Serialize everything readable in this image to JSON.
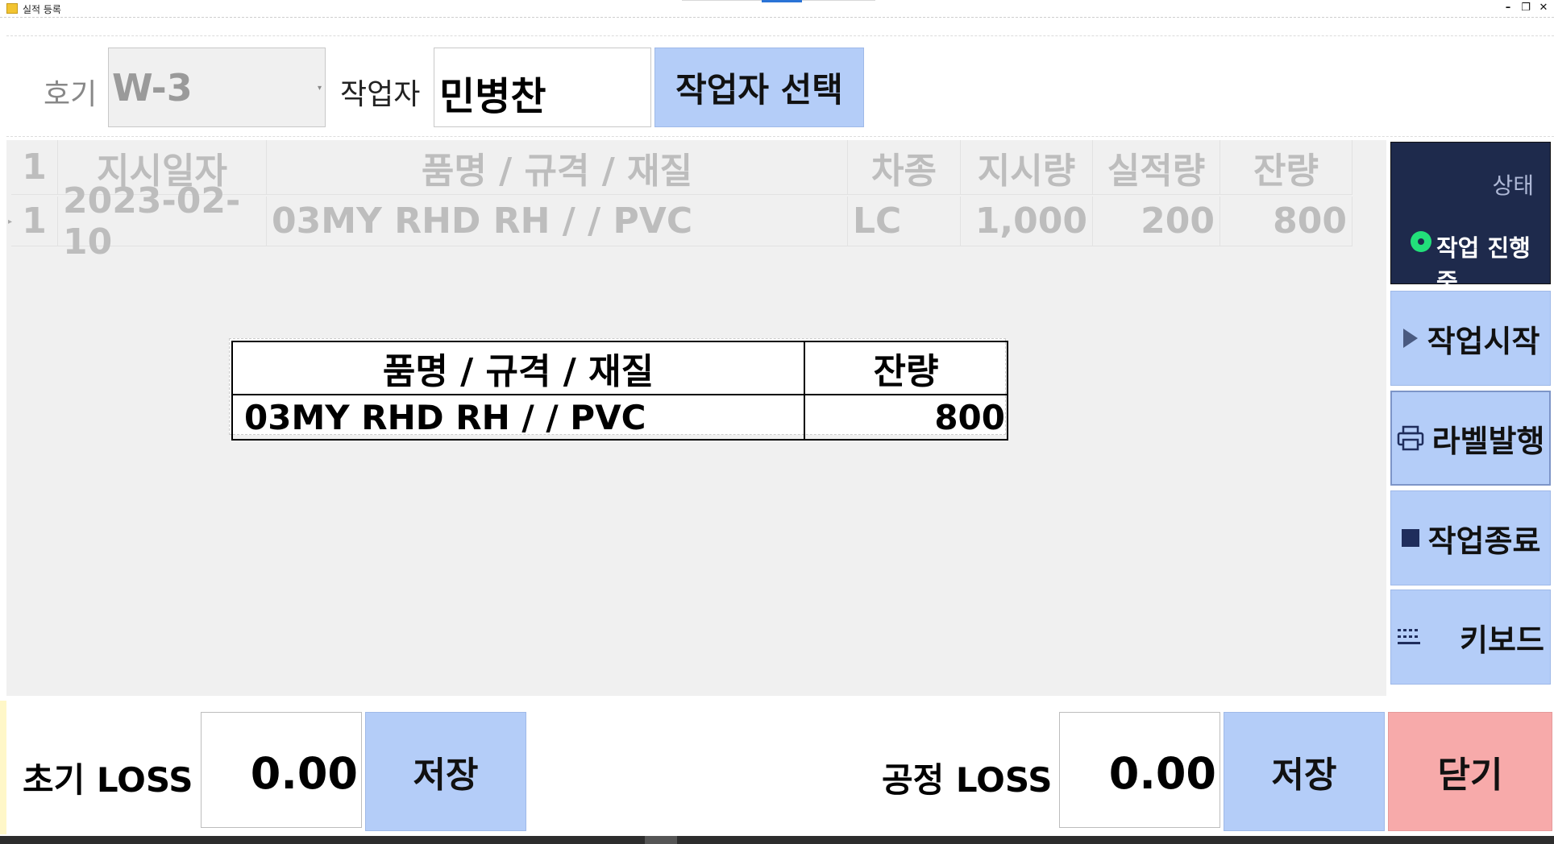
{
  "window": {
    "title": "실적 등록",
    "controls": [
      "–",
      "❐",
      "✕"
    ]
  },
  "top": {
    "hogi_label": "호기",
    "hogi_value": "W-3",
    "worker_label": "작업자",
    "worker_value": "민병찬",
    "select_worker_button": "작업자 선택"
  },
  "grid": {
    "headers": [
      "1",
      "지시일자",
      "품명 / 규격 / 재질",
      "차종",
      "지시량",
      "실적량",
      "잔량"
    ],
    "rows": [
      [
        "1",
        "2023-02-10",
        "03MY RHD RH /  / PVC",
        "LC",
        "1,000",
        "200",
        "800"
      ]
    ]
  },
  "popup": {
    "headers": [
      "품명 / 규격 / 재질",
      "잔량"
    ],
    "rows": [
      [
        "03MY RHD RH /  / PVC",
        "800"
      ]
    ]
  },
  "status": {
    "title": "상태",
    "text": "작업 진행 중",
    "indicator_color": "#22e07a"
  },
  "side_buttons": {
    "start": "작업시작",
    "label": "라벨발행",
    "end": "작업종료",
    "keyboard": "키보드"
  },
  "bottom": {
    "initial_loss_label": "초기 LOSS",
    "initial_loss_value": "0.00",
    "save_label": "저장",
    "process_loss_label": "공정 LOSS",
    "process_loss_value": "0.00",
    "close_label": "닫기"
  },
  "colors": {
    "button_blue": "#b4cdf8",
    "close_red": "#f7aaaa",
    "status_bg": "#1e2a4c"
  }
}
